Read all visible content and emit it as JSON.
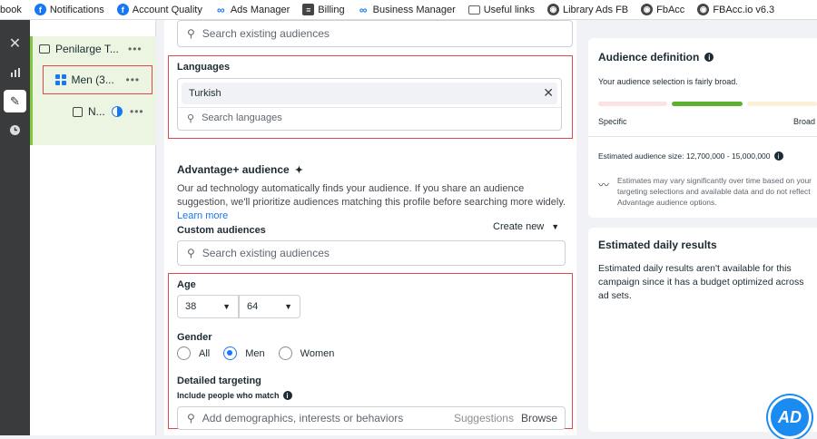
{
  "bookmarks": [
    {
      "label": "book",
      "icon": "none"
    },
    {
      "label": "Notifications",
      "icon": "facebook-icon"
    },
    {
      "label": "Account Quality",
      "icon": "facebook-icon"
    },
    {
      "label": "Ads Manager",
      "icon": "meta-icon"
    },
    {
      "label": "Billing",
      "icon": "billing-icon"
    },
    {
      "label": "Business Manager",
      "icon": "meta-icon"
    },
    {
      "label": "Useful links",
      "icon": "folder-icon"
    },
    {
      "label": "Library Ads FB",
      "icon": "globe-icon"
    },
    {
      "label": "FbAcc",
      "icon": "globe-icon"
    },
    {
      "label": "FBAcc.io v6.3",
      "icon": "globe-icon"
    }
  ],
  "tree": {
    "campaign": "Penilarge T...",
    "adset": "Men (3...",
    "ad": "N..."
  },
  "top_search_placeholder": "Search existing audiences",
  "languages": {
    "title": "Languages",
    "selected": "Turkish",
    "search_placeholder": "Search languages"
  },
  "advantage": {
    "title": "Advantage+ audience",
    "description": "Our ad technology automatically finds your audience. If you share an audience suggestion, we'll prioritize audiences matching this profile before searching more widely.",
    "learn_more": "Learn more",
    "custom_audiences_label": "Custom audiences",
    "create_new": "Create new",
    "custom_search_placeholder": "Search existing audiences"
  },
  "age": {
    "label": "Age",
    "min": "38",
    "max": "64"
  },
  "gender": {
    "label": "Gender",
    "options": [
      "All",
      "Men",
      "Women"
    ],
    "selected": "Men"
  },
  "detailed_targeting": {
    "label": "Detailed targeting",
    "sublabel": "Include people who match",
    "placeholder": "Add demographics, interests or behaviors",
    "suggestions": "Suggestions",
    "browse": "Browse"
  },
  "audience_definition": {
    "title": "Audience definition",
    "status": "Your audience selection is fairly broad.",
    "specific": "Specific",
    "broad": "Broad",
    "estimated_size": "Estimated audience size: 12,700,000 - 15,000,000",
    "note": "Estimates may vary significantly over time based on your targeting selections and available data and do not reflect Advantage audience options.",
    "level": 0.5
  },
  "daily_results": {
    "title": "Estimated daily results",
    "text": "Estimated daily results aren't available for this campaign since it has a budget optimized across ad sets."
  },
  "colors": {
    "accent": "#1877f2",
    "green": "#5db12c",
    "red_box": "#e0474c"
  }
}
